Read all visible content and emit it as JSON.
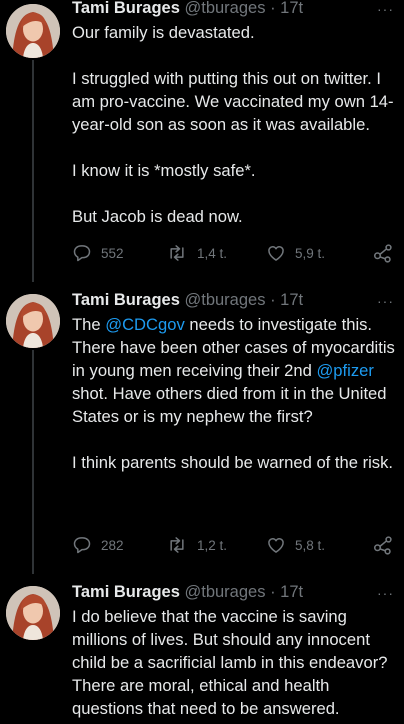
{
  "tweets": [
    {
      "name": "Tami Burages",
      "handle": "@tburages",
      "separator": "·",
      "time": "17t",
      "more": "···",
      "paragraphs": [
        [
          "Our family is devastated."
        ],
        [
          "I struggled with putting this out on twitter. I am pro-vaccine. We vaccinated my own 14-year-old son as soon as it was available."
        ],
        [
          "I know it is *mostly safe*."
        ],
        [
          "But Jacob is dead now."
        ]
      ],
      "replies": "552",
      "retweets": "1,4 t.",
      "likes": "5,9 t."
    },
    {
      "name": "Tami Burages",
      "handle": "@tburages",
      "separator": "·",
      "time": "17t",
      "more": "···",
      "p1_a": "The ",
      "p1_mention1": "@CDCgov",
      "p1_b": " needs to investigate this. There have been other cases of myocarditis in young men receiving their 2nd ",
      "p1_mention2": "@pfizer",
      "p1_c": " shot. Have others died from it in the United States or is my nephew the first?",
      "p2": "I think parents should be warned of the risk.",
      "replies": "282",
      "retweets": "1,2 t.",
      "likes": "5,8 t."
    },
    {
      "name": "Tami Burages",
      "handle": "@tburages",
      "separator": "·",
      "time": "17t",
      "more": "···",
      "p1": "I do believe that the vaccine is saving millions of lives. But should any innocent child be a sacrificial lamb in this endeavor? There are moral, ethical and health questions that need to be answered."
    }
  ],
  "icons": {
    "reply": "reply-icon",
    "retweet": "retweet-icon",
    "like": "heart-icon",
    "share": "share-icon"
  }
}
